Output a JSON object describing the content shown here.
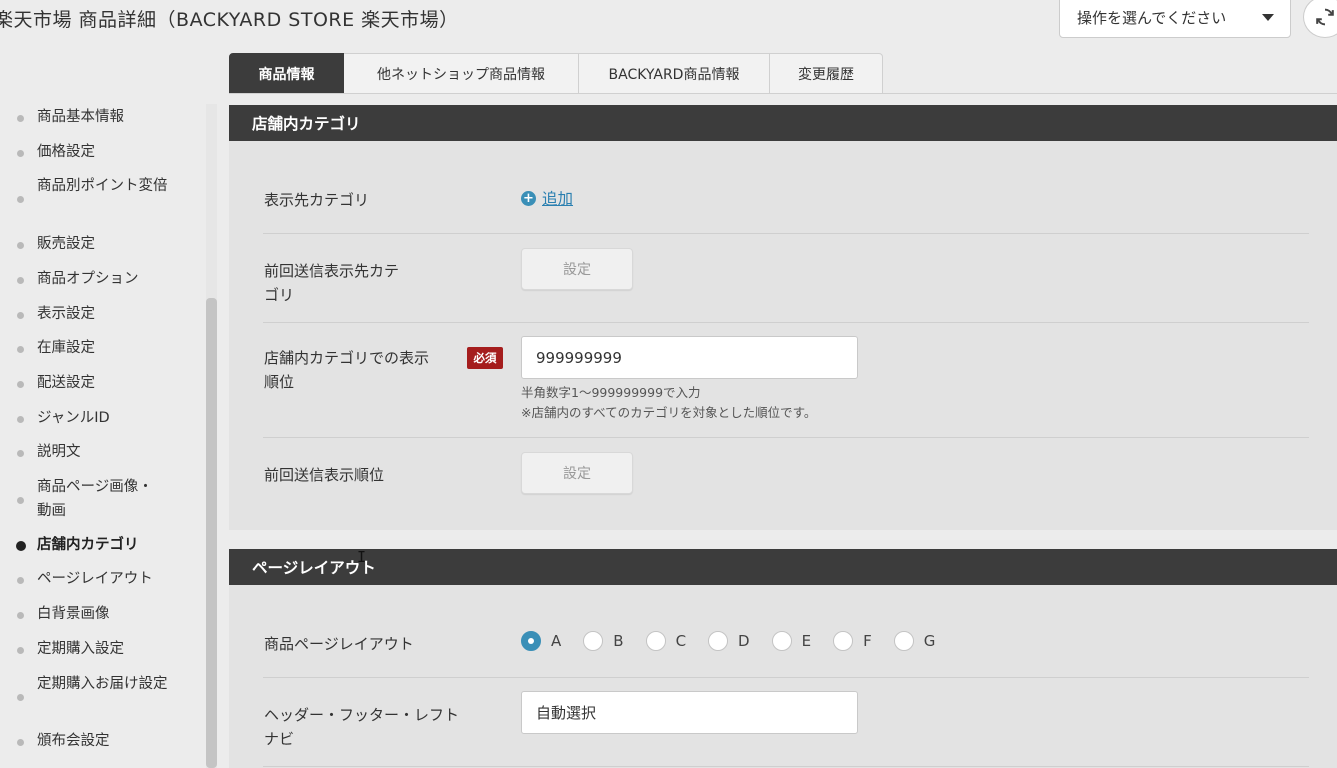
{
  "header": {
    "title": "楽天市場 商品詳細（BACKYARD STORE 楽天市場）",
    "action_select": "操作を選んでください"
  },
  "tabs": [
    {
      "label": "商品情報",
      "active": true
    },
    {
      "label": "他ネットショップ商品情報",
      "active": false
    },
    {
      "label": "BACKYARD商品情報",
      "active": false
    },
    {
      "label": "変更履歴",
      "active": false
    }
  ],
  "sidebar": {
    "items": [
      {
        "label": "商品基本情報"
      },
      {
        "label": "価格設定"
      },
      {
        "label": "商品別ポイント変倍"
      },
      {
        "label": "販売設定"
      },
      {
        "label": "商品オプション"
      },
      {
        "label": "表示設定"
      },
      {
        "label": "在庫設定"
      },
      {
        "label": "配送設定"
      },
      {
        "label": "ジャンルID"
      },
      {
        "label": "説明文"
      },
      {
        "label": "商品ページ画像・動画"
      },
      {
        "label": "店舗内カテゴリ",
        "active": true
      },
      {
        "label": "ページレイアウト"
      },
      {
        "label": "白背景画像"
      },
      {
        "label": "定期購入設定"
      },
      {
        "label": "定期購入お届け設定"
      },
      {
        "label": "頒布会設定"
      }
    ]
  },
  "category_section": {
    "title": "店舗内カテゴリ",
    "display_category_label": "表示先カテゴリ",
    "add_label": "追加",
    "prev_display_category_label": "前回送信表示先カテゴリ",
    "set_label": "設定",
    "order_label": "店舗内カテゴリでの表示順位",
    "required_label": "必須",
    "order_value": "999999999",
    "hint1": "半角数字1～999999999で入力",
    "hint2": "※店舗内のすべてのカテゴリを対象とした順位です。",
    "prev_order_label": "前回送信表示順位",
    "set_label2": "設定"
  },
  "layout_section": {
    "title": "ページレイアウト",
    "page_layout_label": "商品ページレイアウト",
    "options": [
      "A",
      "B",
      "C",
      "D",
      "E",
      "F",
      "G"
    ],
    "selected": "A",
    "header_footer_label": "ヘッダー・フッター・レフトナビ",
    "header_footer_value": "自動選択"
  },
  "colors": {
    "accent": "#3a8fb7",
    "header_bg": "#3c3c3c",
    "required": "#a51d1d"
  }
}
